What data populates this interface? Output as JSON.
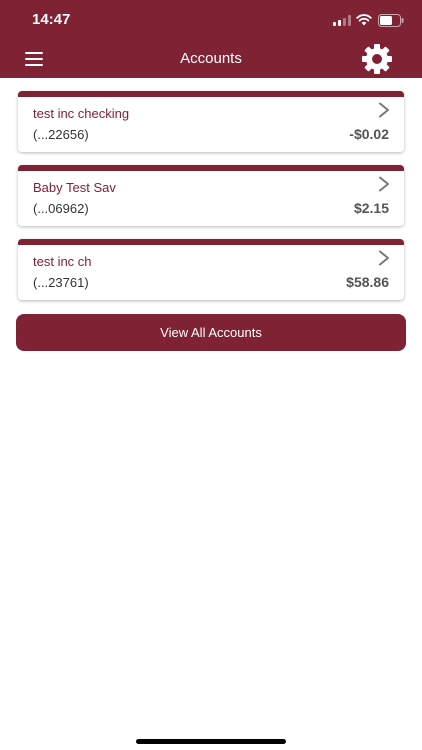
{
  "status_bar": {
    "time": "14:47"
  },
  "header": {
    "title": "Accounts",
    "menu_icon": "hamburger-menu-icon",
    "settings_icon": "gear-icon"
  },
  "accounts": [
    {
      "name": "test inc checking",
      "number": "(...22656)",
      "balance": "-$0.02"
    },
    {
      "name": "Baby Test Sav",
      "number": "(...06962)",
      "balance": "$2.15"
    },
    {
      "name": "test inc ch",
      "number": "(...23761)",
      "balance": "$58.86"
    }
  ],
  "view_all_label": "View All Accounts",
  "colors": {
    "brand": "#7f2234",
    "background": "#ffffff",
    "balance_text": "#555555"
  }
}
